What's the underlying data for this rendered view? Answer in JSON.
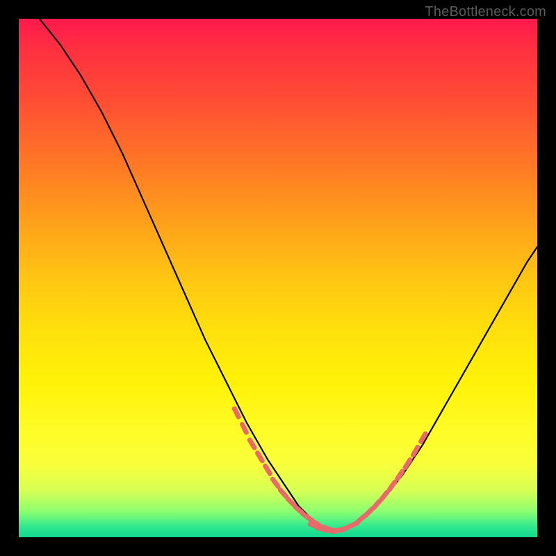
{
  "watermark": "TheBottleneck.com",
  "chart_data": {
    "type": "line",
    "title": "",
    "xlabel": "",
    "ylabel": "",
    "xlim": [
      0,
      100
    ],
    "ylim": [
      0,
      100
    ],
    "grid": false,
    "legend": false,
    "series": [
      {
        "name": "bottleneck-curve",
        "color": "#000000",
        "x": [
          4,
          8,
          12,
          16,
          20,
          24,
          28,
          32,
          36,
          40,
          44,
          48,
          50,
          52,
          54,
          56,
          58,
          60,
          62,
          64,
          66,
          70,
          74,
          78,
          82,
          86,
          90,
          94,
          98,
          100
        ],
        "y": [
          100,
          95,
          89,
          82,
          74,
          65,
          56,
          47,
          38,
          30,
          22,
          15,
          12,
          9,
          6,
          4,
          2.5,
          1.5,
          1.5,
          2,
          3.5,
          7,
          12,
          18,
          25,
          32,
          39,
          46,
          53,
          56
        ]
      },
      {
        "name": "highlight-dots-left",
        "color": "#e86a6a",
        "x": [
          42,
          43.5,
          45,
          46.5,
          48,
          49.5,
          51,
          52.5,
          54,
          55.5,
          57,
          58.5,
          60
        ],
        "y": [
          24,
          21,
          18,
          15.5,
          13,
          10.5,
          8.5,
          6.8,
          5.3,
          4,
          2.9,
          2,
          1.5
        ]
      },
      {
        "name": "highlight-dots-bottom",
        "color": "#e86a6a",
        "x": [
          57,
          58.5,
          60,
          61.5,
          63,
          64.5
        ],
        "y": [
          2.2,
          1.6,
          1.3,
          1.3,
          1.7,
          2.4
        ]
      },
      {
        "name": "highlight-dots-right",
        "color": "#e86a6a",
        "x": [
          66,
          67.5,
          69,
          70.5,
          72,
          73.5,
          75,
          76.5,
          78
        ],
        "y": [
          3.5,
          4.8,
          6.3,
          8,
          9.9,
          12,
          14.2,
          16.6,
          19.2
        ]
      }
    ],
    "gradient_stops": [
      {
        "pos": 0,
        "color": "#ff1a4d"
      },
      {
        "pos": 50,
        "color": "#ffc812"
      },
      {
        "pos": 85,
        "color": "#fffc28"
      },
      {
        "pos": 100,
        "color": "#10d890"
      }
    ]
  }
}
